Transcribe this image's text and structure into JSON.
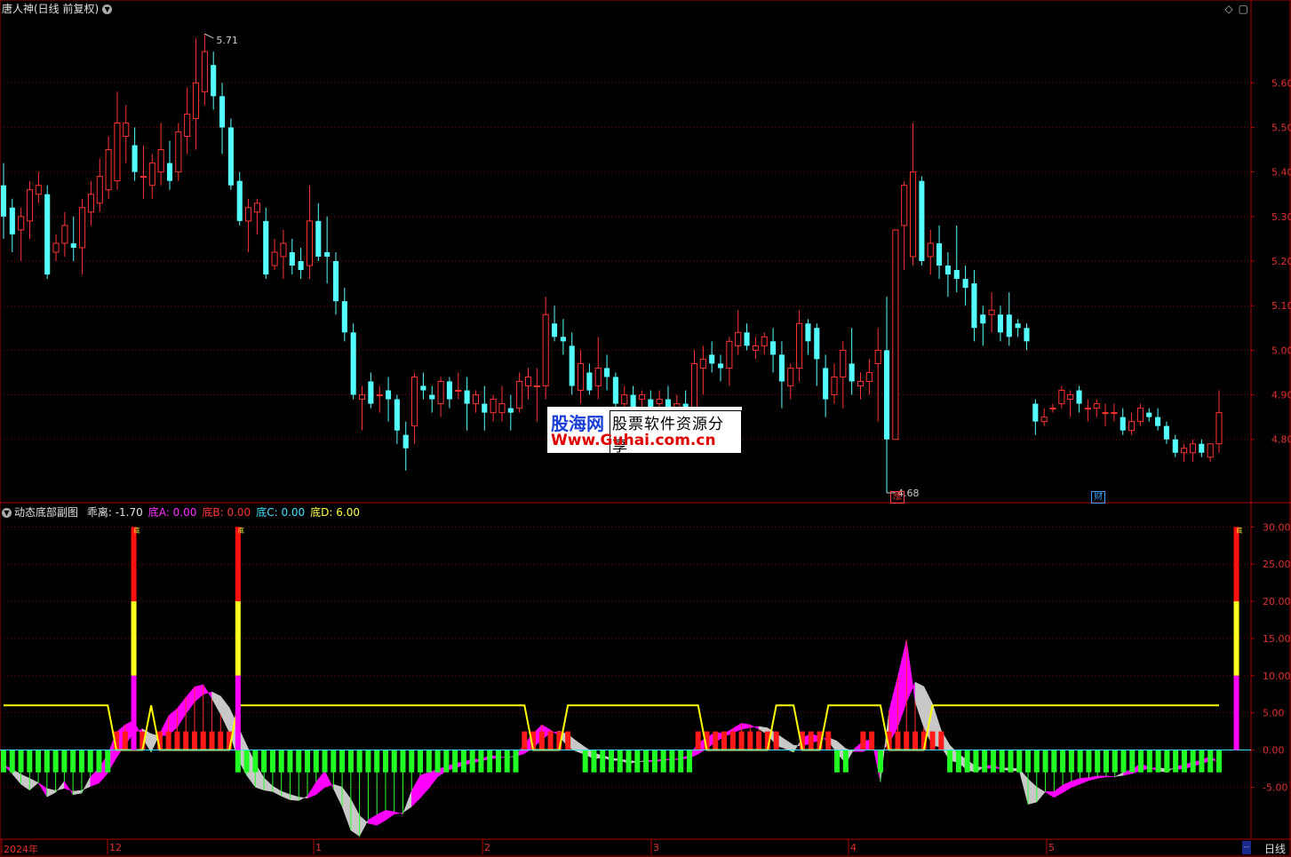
{
  "window": {
    "title": "唐人神(日线 前复权)",
    "icons": [
      "diamond-icon",
      "maximize-icon"
    ]
  },
  "price_panel": {
    "yaxis_ticks": [
      "5.60",
      "5.50",
      "5.40",
      "5.30",
      "5.20",
      "5.10",
      "5.00",
      "4.90",
      "4.80"
    ],
    "high_label": "5.71",
    "low_label": "4.68",
    "badges": [
      {
        "text": "涨",
        "color": "#ff4040"
      },
      {
        "text": "财",
        "color": "#3aa0ff"
      }
    ]
  },
  "indicator_panel": {
    "name": "动态底部副图",
    "legend": [
      {
        "label": "乖离:",
        "value": "-1.70",
        "color": "#e0e0e0"
      },
      {
        "label": "底A:",
        "value": "0.00",
        "color": "#ff30ff"
      },
      {
        "label": "底B:",
        "value": "0.00",
        "color": "#ff3030"
      },
      {
        "label": "底C:",
        "value": "0.00",
        "color": "#40e0ff"
      },
      {
        "label": "底D:",
        "value": "6.00",
        "color": "#ffff40"
      }
    ],
    "yaxis_ticks": [
      "30.00",
      "25.00",
      "20.00",
      "15.00",
      "10.00",
      "5.00",
      "0.00",
      "-5.00"
    ],
    "signal_label": "底"
  },
  "x_axis": {
    "labels": [
      "2024年",
      "12",
      "1",
      "2",
      "3",
      "4",
      "5"
    ],
    "period_label": "日线",
    "scroll_label": "--"
  },
  "watermark": {
    "brand": "股海网",
    "tagline": "股票软件资源分享",
    "url": "Www.Guhai.com.cn"
  },
  "colors": {
    "up": "#ff3232",
    "down": "#54ffff",
    "grid": "#7a0000",
    "axis": "#b00000",
    "bias_line": "#ffff00",
    "magenta": "#ff00ff",
    "gray_fill": "#c8c8c8"
  },
  "chart_data": {
    "type": "candlestick",
    "series_ohlc": [
      [
        5.37,
        5.42,
        5.25,
        5.3
      ],
      [
        5.32,
        5.34,
        5.22,
        5.26
      ],
      [
        5.27,
        5.32,
        5.2,
        5.3
      ],
      [
        5.29,
        5.38,
        5.25,
        5.36
      ],
      [
        5.35,
        5.4,
        5.33,
        5.37
      ],
      [
        5.35,
        5.37,
        5.16,
        5.17
      ],
      [
        5.22,
        5.26,
        5.2,
        5.24
      ],
      [
        5.24,
        5.31,
        5.21,
        5.28
      ],
      [
        5.24,
        5.3,
        5.2,
        5.23
      ],
      [
        5.23,
        5.34,
        5.17,
        5.32
      ],
      [
        5.31,
        5.38,
        5.28,
        5.35
      ],
      [
        5.33,
        5.43,
        5.31,
        5.39
      ],
      [
        5.36,
        5.48,
        5.34,
        5.45
      ],
      [
        5.38,
        5.58,
        5.36,
        5.51
      ],
      [
        5.48,
        5.55,
        5.42,
        5.51
      ],
      [
        5.46,
        5.5,
        5.38,
        5.4
      ],
      [
        5.39,
        5.46,
        5.34,
        5.39
      ],
      [
        5.37,
        5.44,
        5.34,
        5.42
      ],
      [
        5.4,
        5.51,
        5.37,
        5.45
      ],
      [
        5.42,
        5.47,
        5.36,
        5.38
      ],
      [
        5.4,
        5.51,
        5.38,
        5.49
      ],
      [
        5.48,
        5.59,
        5.44,
        5.53
      ],
      [
        5.52,
        5.7,
        5.45,
        5.6
      ],
      [
        5.58,
        5.71,
        5.55,
        5.67
      ],
      [
        5.64,
        5.67,
        5.54,
        5.57
      ],
      [
        5.57,
        5.6,
        5.44,
        5.5
      ],
      [
        5.5,
        5.52,
        5.36,
        5.37
      ],
      [
        5.38,
        5.4,
        5.28,
        5.29
      ],
      [
        5.29,
        5.34,
        5.22,
        5.32
      ],
      [
        5.31,
        5.34,
        5.26,
        5.33
      ],
      [
        5.29,
        5.32,
        5.16,
        5.17
      ],
      [
        5.19,
        5.25,
        5.18,
        5.22
      ],
      [
        5.21,
        5.27,
        5.16,
        5.24
      ],
      [
        5.22,
        5.25,
        5.17,
        5.19
      ],
      [
        5.2,
        5.23,
        5.16,
        5.18
      ],
      [
        5.19,
        5.37,
        5.16,
        5.29
      ],
      [
        5.29,
        5.33,
        5.2,
        5.21
      ],
      [
        5.22,
        5.3,
        5.15,
        5.21
      ],
      [
        5.2,
        5.22,
        5.08,
        5.11
      ],
      [
        5.11,
        5.14,
        5.02,
        5.04
      ],
      [
        5.04,
        5.06,
        4.89,
        4.9
      ],
      [
        4.89,
        4.92,
        4.82,
        4.9
      ],
      [
        4.93,
        4.95,
        4.87,
        4.88
      ],
      [
        4.9,
        4.92,
        4.86,
        4.9
      ],
      [
        4.91,
        4.94,
        4.84,
        4.89
      ],
      [
        4.89,
        4.9,
        4.79,
        4.82
      ],
      [
        4.81,
        4.84,
        4.73,
        4.78
      ],
      [
        4.83,
        4.95,
        4.79,
        4.94
      ],
      [
        4.92,
        4.95,
        4.89,
        4.91
      ],
      [
        4.9,
        4.92,
        4.86,
        4.89
      ],
      [
        4.88,
        4.94,
        4.85,
        4.93
      ],
      [
        4.93,
        4.94,
        4.87,
        4.89
      ],
      [
        4.91,
        4.95,
        4.89,
        4.91
      ],
      [
        4.91,
        4.94,
        4.82,
        4.88
      ],
      [
        4.88,
        4.91,
        4.86,
        4.9
      ],
      [
        4.88,
        4.92,
        4.82,
        4.86
      ],
      [
        4.86,
        4.9,
        4.84,
        4.89
      ],
      [
        4.86,
        4.92,
        4.84,
        4.88
      ],
      [
        4.87,
        4.9,
        4.82,
        4.86
      ],
      [
        4.87,
        4.95,
        4.86,
        4.93
      ],
      [
        4.92,
        4.96,
        4.89,
        4.94
      ],
      [
        4.92,
        4.96,
        4.84,
        4.92
      ],
      [
        4.92,
        5.12,
        4.89,
        5.08
      ],
      [
        5.06,
        5.1,
        5.02,
        5.03
      ],
      [
        5.03,
        5.07,
        4.99,
        5.02
      ],
      [
        5.01,
        5.04,
        4.9,
        4.92
      ],
      [
        4.91,
        5.0,
        4.88,
        4.97
      ],
      [
        4.95,
        4.97,
        4.9,
        4.91
      ],
      [
        4.92,
        5.03,
        4.89,
        4.96
      ],
      [
        4.96,
        4.99,
        4.91,
        4.94
      ],
      [
        4.94,
        4.95,
        4.87,
        4.88
      ],
      [
        4.88,
        4.92,
        4.86,
        4.9
      ],
      [
        4.9,
        4.92,
        4.86,
        4.87
      ],
      [
        4.89,
        4.91,
        4.85,
        4.9
      ],
      [
        4.89,
        4.91,
        4.85,
        4.87
      ],
      [
        4.88,
        4.91,
        4.85,
        4.89
      ],
      [
        4.89,
        4.92,
        4.83,
        4.85
      ],
      [
        4.85,
        4.9,
        4.82,
        4.88
      ],
      [
        4.88,
        4.91,
        4.85,
        4.86
      ],
      [
        4.86,
        5.0,
        4.84,
        4.97
      ],
      [
        4.96,
        5.01,
        4.9,
        4.98
      ],
      [
        4.99,
        5.02,
        4.95,
        4.97
      ],
      [
        4.97,
        4.99,
        4.93,
        4.96
      ],
      [
        4.96,
        5.03,
        4.92,
        5.02
      ],
      [
        5.01,
        5.09,
        4.99,
        5.04
      ],
      [
        5.04,
        5.06,
        5.0,
        5.01
      ],
      [
        5.0,
        5.03,
        4.98,
        5.01
      ],
      [
        5.01,
        5.04,
        4.99,
        5.03
      ],
      [
        5.02,
        5.05,
        4.95,
        4.99
      ],
      [
        4.99,
        5.02,
        4.87,
        4.93
      ],
      [
        4.92,
        4.97,
        4.89,
        4.96
      ],
      [
        4.96,
        5.09,
        4.93,
        5.06
      ],
      [
        5.06,
        5.07,
        4.99,
        5.02
      ],
      [
        5.05,
        5.06,
        4.92,
        4.98
      ],
      [
        4.96,
        4.99,
        4.85,
        4.89
      ],
      [
        4.9,
        4.97,
        4.88,
        4.94
      ],
      [
        4.94,
        5.02,
        4.87,
        5.0
      ],
      [
        4.97,
        5.05,
        4.9,
        4.93
      ],
      [
        4.92,
        4.95,
        4.89,
        4.93
      ],
      [
        4.93,
        4.98,
        4.9,
        4.95
      ],
      [
        4.97,
        5.05,
        4.84,
        5.0
      ],
      [
        5.0,
        5.12,
        4.68,
        4.8
      ],
      [
        4.8,
        5.27,
        4.8,
        5.27
      ],
      [
        5.28,
        5.38,
        5.18,
        5.37
      ],
      [
        5.21,
        5.51,
        5.19,
        5.4
      ],
      [
        5.38,
        5.39,
        5.19,
        5.2
      ],
      [
        5.21,
        5.27,
        5.17,
        5.24
      ],
      [
        5.24,
        5.28,
        5.16,
        5.19
      ],
      [
        5.19,
        5.22,
        5.12,
        5.17
      ],
      [
        5.18,
        5.28,
        5.13,
        5.16
      ],
      [
        5.16,
        5.19,
        5.1,
        5.14
      ],
      [
        5.15,
        5.18,
        5.02,
        5.05
      ],
      [
        5.08,
        5.1,
        5.01,
        5.06
      ],
      [
        5.08,
        5.13,
        5.04,
        5.09
      ],
      [
        5.08,
        5.1,
        5.02,
        5.04
      ],
      [
        5.08,
        5.13,
        5.01,
        5.03
      ],
      [
        5.06,
        5.07,
        5.03,
        5.05
      ],
      [
        5.05,
        5.06,
        5.0,
        5.02
      ],
      [
        4.88,
        4.89,
        4.81,
        4.84
      ],
      [
        4.84,
        4.87,
        4.83,
        4.85
      ],
      [
        4.87,
        4.88,
        4.86,
        4.87
      ],
      [
        4.88,
        4.92,
        4.87,
        4.91
      ],
      [
        4.89,
        4.91,
        4.85,
        4.9
      ],
      [
        4.91,
        4.92,
        4.86,
        4.88
      ],
      [
        4.87,
        4.89,
        4.84,
        4.87
      ],
      [
        4.87,
        4.89,
        4.85,
        4.88
      ],
      [
        4.86,
        4.88,
        4.83,
        4.86
      ],
      [
        4.86,
        4.88,
        4.84,
        4.86
      ],
      [
        4.85,
        4.87,
        4.81,
        4.82
      ],
      [
        4.82,
        4.86,
        4.81,
        4.84
      ],
      [
        4.84,
        4.88,
        4.83,
        4.87
      ],
      [
        4.86,
        4.87,
        4.84,
        4.85
      ],
      [
        4.85,
        4.87,
        4.82,
        4.83
      ],
      [
        4.83,
        4.84,
        4.79,
        4.8
      ],
      [
        4.8,
        4.81,
        4.76,
        4.77
      ],
      [
        4.77,
        4.79,
        4.75,
        4.78
      ],
      [
        4.77,
        4.8,
        4.75,
        4.79
      ],
      [
        4.79,
        4.8,
        4.76,
        4.77
      ],
      [
        4.76,
        4.78,
        4.75,
        4.79
      ],
      [
        4.79,
        4.91,
        4.77,
        4.86
      ]
    ],
    "bias_ohlc_note": "",
    "indicator_bias_values": [
      -2.0,
      -3.2,
      -4.6,
      -5.4,
      -4.4,
      -6.3,
      -5.7,
      -4.2,
      -6.0,
      -5.8,
      -3.6,
      -2.4,
      -0.6,
      2.4,
      3.4,
      4.0,
      1.6,
      -0.3,
      2.2,
      4.6,
      5.6,
      7.1,
      8.5,
      8.8,
      6.9,
      4.8,
      2.4,
      -1.2,
      -3.4,
      -5.0,
      -5.4,
      -5.6,
      -6.2,
      -6.7,
      -6.8,
      -6.2,
      -4.3,
      -2.8,
      -5.2,
      -7.6,
      -10.8,
      -11.6,
      -9.4,
      -8.7,
      -8.1,
      -8.3,
      -8.6,
      -5.5,
      -3.4,
      -3.0,
      -2.6,
      -2.2,
      -1.8,
      -1.6,
      -1.2,
      -1.3,
      -0.7,
      -0.9,
      -1.0,
      -0.8,
      0.8,
      2.2,
      3.4,
      2.7,
      1.9,
      0.4,
      -0.2,
      -0.6,
      -1.2,
      -1.0,
      -1.4,
      -1.4,
      -1.8,
      -1.6,
      -1.4,
      -1.4,
      -1.2,
      -1.3,
      -1.1,
      -0.7,
      0.9,
      1.7,
      2.4,
      2.2,
      2.9,
      3.6,
      3.4,
      2.8,
      2.1,
      0.6,
      0.2,
      -0.3,
      1.6,
      2.2,
      1.8,
      1.2,
      -0.4,
      -1.8,
      0.2,
      1.2,
      1.4,
      -4.3,
      5.3,
      9.9,
      14.8,
      6.5,
      3.0,
      0.6,
      0.4,
      -1.4,
      -1.7,
      -2.7,
      -3.0,
      -2.2,
      -2.0,
      -2.6,
      -2.8,
      -2.8,
      -7.3,
      -7.0,
      -5.6,
      -5.6,
      -4.7,
      -4.2,
      -3.8,
      -3.7,
      -3.5,
      -3.5,
      -3.6,
      -3.0,
      -2.6,
      -1.8,
      -2.4,
      -2.8,
      -3.0,
      -2.2,
      -2.0,
      -1.6,
      -1.4,
      -0.8,
      -1.7
    ],
    "indicator_bottom_signals": [
      15,
      27,
      142
    ],
    "ylim_price": [
      4.66,
      5.75
    ],
    "ylim_indicator": [
      -12,
      31
    ]
  }
}
